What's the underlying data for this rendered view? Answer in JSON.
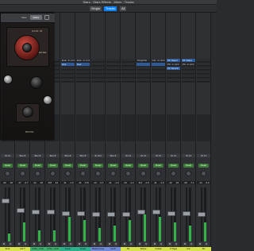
{
  "window": {
    "title": "Stars - Stars Effects - Mixer - Tracks"
  },
  "toolbar": {
    "single_label": "Single",
    "tracks_label": "Tracks",
    "all_label": "All"
  },
  "plugin_window": {
    "view_label": "View",
    "editor_label": "Editor",
    "plate_top_label": "GAIN IN",
    "plate_knob_label": "EDGE",
    "bottom_label": "DRIVE"
  },
  "strips": [
    {
      "io": "St 14",
      "name": "Kick",
      "name_color": "#d7e34a",
      "vol": "-42",
      "pk": "-10",
      "fader": 0.78,
      "meter": 0.15,
      "plugins": [],
      "sends": []
    },
    {
      "io": "Bus 8",
      "name": "Ind 7",
      "name_color": "#d7e34a",
      "vol": "-17",
      "pk": "-4.7",
      "fader": 0.58,
      "meter": 0.35,
      "plugins": [
        {
          "t": "Ena...It +1.0",
          "blue": false
        },
        {
          "t": "Ena...It +1.0",
          "blue": false
        }
      ],
      "sends": []
    },
    {
      "io": "Bus 8",
      "name": "2 Pla...Kick",
      "name_color": "#3fb36e",
      "vol": "-12",
      "pk": "-10",
      "fader": 0.55,
      "meter": 0.2,
      "plugins": [],
      "sends": []
    },
    {
      "io": "Bus 8",
      "name": "2 Pla...Kick",
      "name_color": "#3fb36e",
      "vol": "-8.8",
      "pk": "-12",
      "fader": 0.55,
      "meter": 0.2,
      "plugins": [],
      "sends": []
    },
    {
      "io": "Bus 8",
      "name": "Funk",
      "name_color": "#2bb08c",
      "vol": "-11",
      "pk": "-1.3",
      "fader": 0.52,
      "meter": 0.45,
      "plugins": [
        {
          "t": "Ena...It +1.0",
          "blue": false
        },
        {
          "t": "Noir",
          "blue": true
        }
      ],
      "sends": []
    },
    {
      "io": "Bus 8",
      "name": "Funk",
      "name_color": "#2bb08c",
      "vol": "-11",
      "pk": "-0.8",
      "fader": 0.52,
      "meter": 0.4,
      "plugins": [
        {
          "t": "Ena...It +1.0",
          "blue": false
        },
        {
          "t": "Noir",
          "blue": true
        }
      ],
      "sends": []
    },
    {
      "io": "St Out",
      "name": "References",
      "name_color": "#6f8ad6",
      "vol": "-14",
      "pk": "-2.1",
      "fader": 0.5,
      "meter": 0.25,
      "plugins": [
        {
          "t": "",
          "blue": false
        }
      ],
      "sends": []
    },
    {
      "io": "Bus 8",
      "name": "Verb",
      "name_color": "#6f8ad6",
      "vol": "-11",
      "pk": "-1.3",
      "fader": 0.5,
      "meter": 0.3,
      "plugins": [
        {
          "t": "",
          "blue": false
        }
      ],
      "sends": []
    },
    {
      "io": "St 14",
      "name": "Sh",
      "name_color": "#d7e34a",
      "vol": "-13",
      "pk": "-1.2",
      "fader": 0.5,
      "meter": 0.4,
      "plugins": [],
      "sends": []
    },
    {
      "io": "St 14",
      "name": "Stripe",
      "name_color": "#d7e34a",
      "vol": "-8.2",
      "pk": "-1.0",
      "fader": 0.55,
      "meter": 0.5,
      "plugins": [
        {
          "t": "PingChlo",
          "blue": false
        },
        {
          "t": "",
          "blue": true
        }
      ],
      "sends": []
    },
    {
      "io": "St 14",
      "name": "Guitar",
      "name_color": "#d7e34a",
      "vol": "-11",
      "pk": "-1.0",
      "fader": 0.55,
      "meter": 0.45,
      "plugins": [
        {
          "t": "Flo...d +10.0",
          "blue": false
        },
        {
          "t": "",
          "blue": true
        }
      ],
      "sends": []
    },
    {
      "io": "St 14",
      "name": "Z Tags",
      "name_color": "#d7e34a",
      "vol": "-12",
      "pk": "-10",
      "fader": 0.52,
      "meter": 0.35,
      "plugins": [
        {
          "t": "PF Talent",
          "blue": true
        },
        {
          "t": "PF...it +0.0",
          "blue": false
        },
        {
          "t": "PF Stretch",
          "blue": true
        }
      ],
      "sends": []
    },
    {
      "io": "St 14",
      "name": "Gtr",
      "name_color": "#d7e34a",
      "vol": "-20",
      "pk": "-7.1",
      "fader": 0.52,
      "meter": 0.3,
      "plugins": [
        {
          "t": "PF Tabor",
          "blue": true
        },
        {
          "t": "PF...it +0.0",
          "blue": false
        }
      ],
      "sends": []
    },
    {
      "io": "St 14",
      "name": "Sh",
      "name_color": "#d7e34a",
      "vol": "-14",
      "pk": "-3.4",
      "fader": 0.5,
      "meter": 0.35,
      "plugins": [],
      "sends": []
    }
  ],
  "colors": {
    "accent": "#0a84ff",
    "bus_green": "#3d7a39",
    "plugin_blue": "#2f5b9a"
  }
}
